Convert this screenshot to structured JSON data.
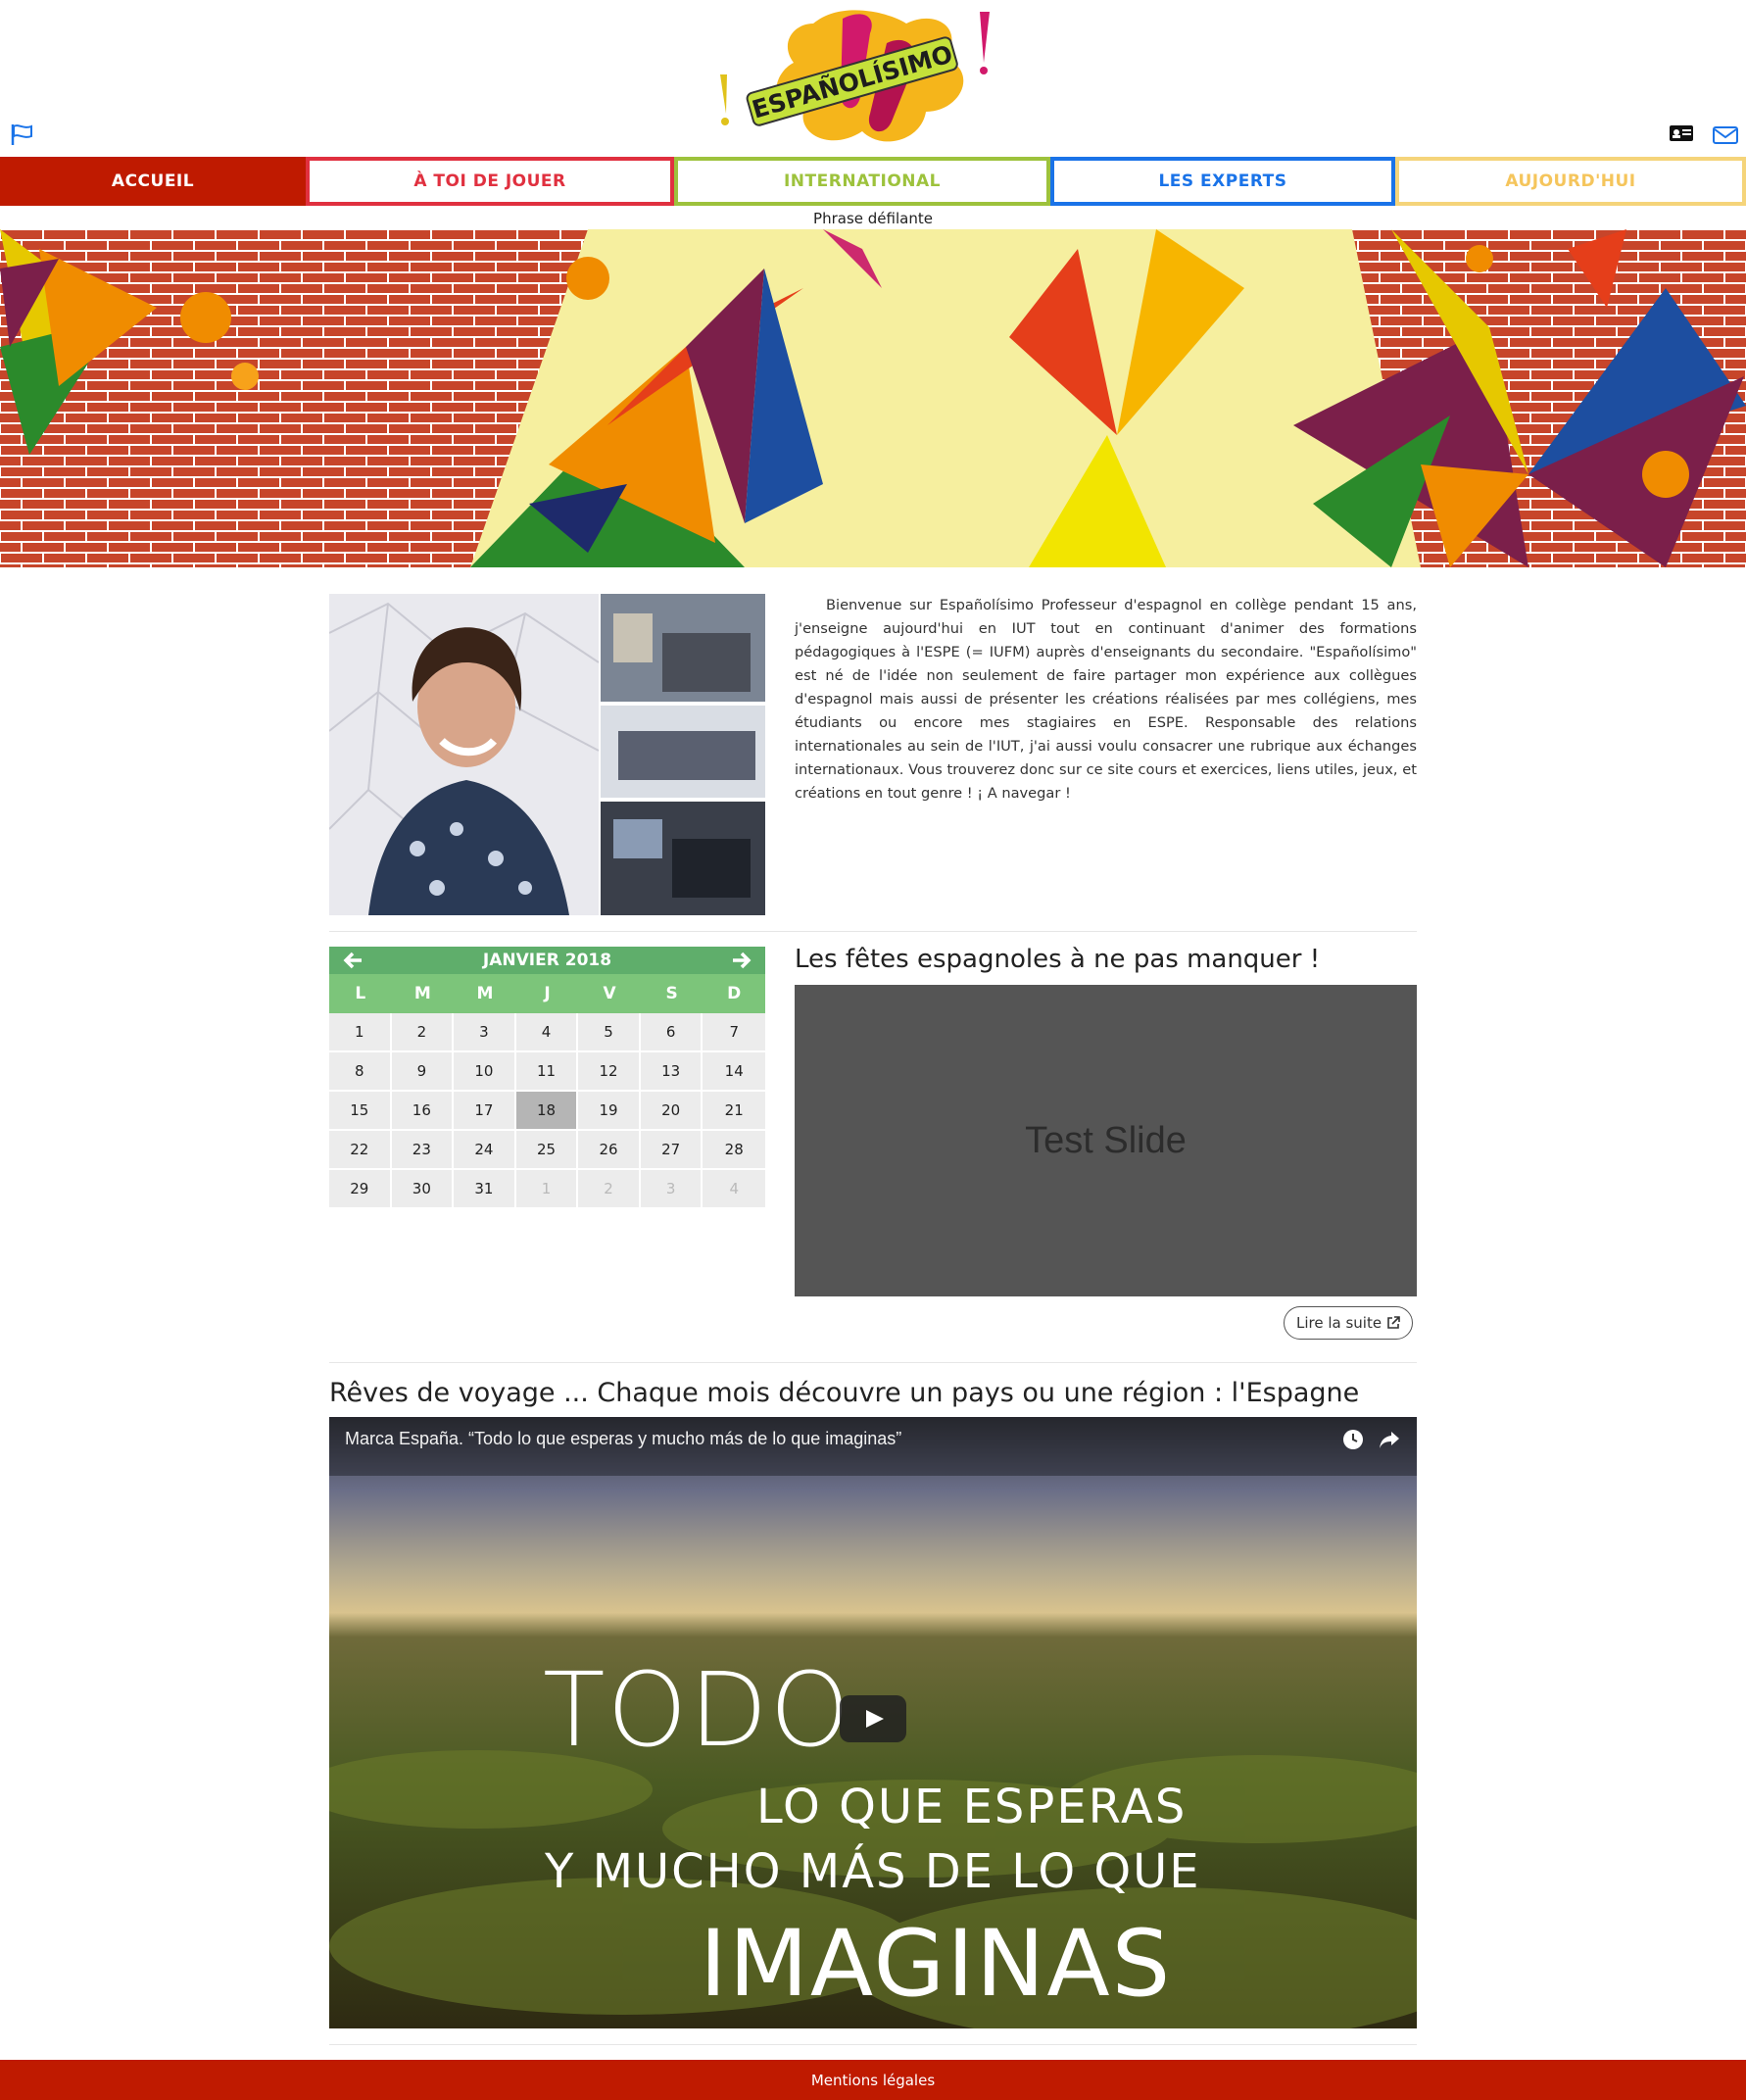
{
  "header": {
    "logo_text": "ESPAÑOLÍSIMO"
  },
  "nav": {
    "items": [
      {
        "label": "ACCUEIL",
        "color": "#bf1a00"
      },
      {
        "label": "À TOI DE JOUER",
        "color": "#e0303f"
      },
      {
        "label": "INTERNATIONAL",
        "color": "#9dc23c"
      },
      {
        "label": "LES EXPERTS",
        "color": "#1a73e8"
      },
      {
        "label": "AUJOURD'HUI",
        "color": "#f5c55c"
      }
    ]
  },
  "ticker": {
    "text": "Phrase défilante"
  },
  "intro": {
    "text": "Bienvenue sur Españolísimo Professeur d'espagnol en collège pendant 15 ans, j'enseigne aujourd'hui en IUT tout en continuant d'animer des formations pédagogiques à l'ESPE (= IUFM) auprès d'enseignants du secondaire. \"Españolísimo\" est né de l'idée non seulement de faire partager mon expérience aux collègues d'espagnol mais aussi de présenter les créations réalisées par mes collégiens, mes étudiants ou encore mes stagiaires en ESPE. Responsable des relations internationales au sein de l'IUT, j'ai aussi voulu consacrer une rubrique aux échanges internationaux. Vous trouverez donc sur ce site cours et exercices, liens utiles, jeux, et créations en tout genre ! ¡ A navegar !"
  },
  "calendar": {
    "title": "JANVIER 2018",
    "weekdays": [
      "L",
      "M",
      "M",
      "J",
      "V",
      "S",
      "D"
    ],
    "days": [
      "1",
      "2",
      "3",
      "4",
      "5",
      "6",
      "7",
      "8",
      "9",
      "10",
      "11",
      "12",
      "13",
      "14",
      "15",
      "16",
      "17",
      "18",
      "19",
      "20",
      "21",
      "22",
      "23",
      "24",
      "25",
      "26",
      "27",
      "28",
      "29",
      "30",
      "31",
      "1",
      "2",
      "3",
      "4"
    ],
    "today": "18",
    "header_color": "#5fae6b",
    "weekday_color": "#7cc57a"
  },
  "fetes": {
    "title": "Les fêtes espagnoles à ne pas manquer !",
    "slide_text": "Test Slide",
    "read_more": "Lire la suite"
  },
  "voyage": {
    "title": "Rêves de voyage ... Chaque mois découvre un pays ou une région : l'Espagne",
    "video_title": "Marca España. “Todo lo que esperas y mucho más de lo que imaginas”",
    "overlay": [
      "TODO",
      "LO QUE ESPERAS",
      "Y MUCHO MÁS DE LO QUE",
      "IMAGINAS"
    ]
  },
  "footer": {
    "link": "Mentions légales"
  }
}
